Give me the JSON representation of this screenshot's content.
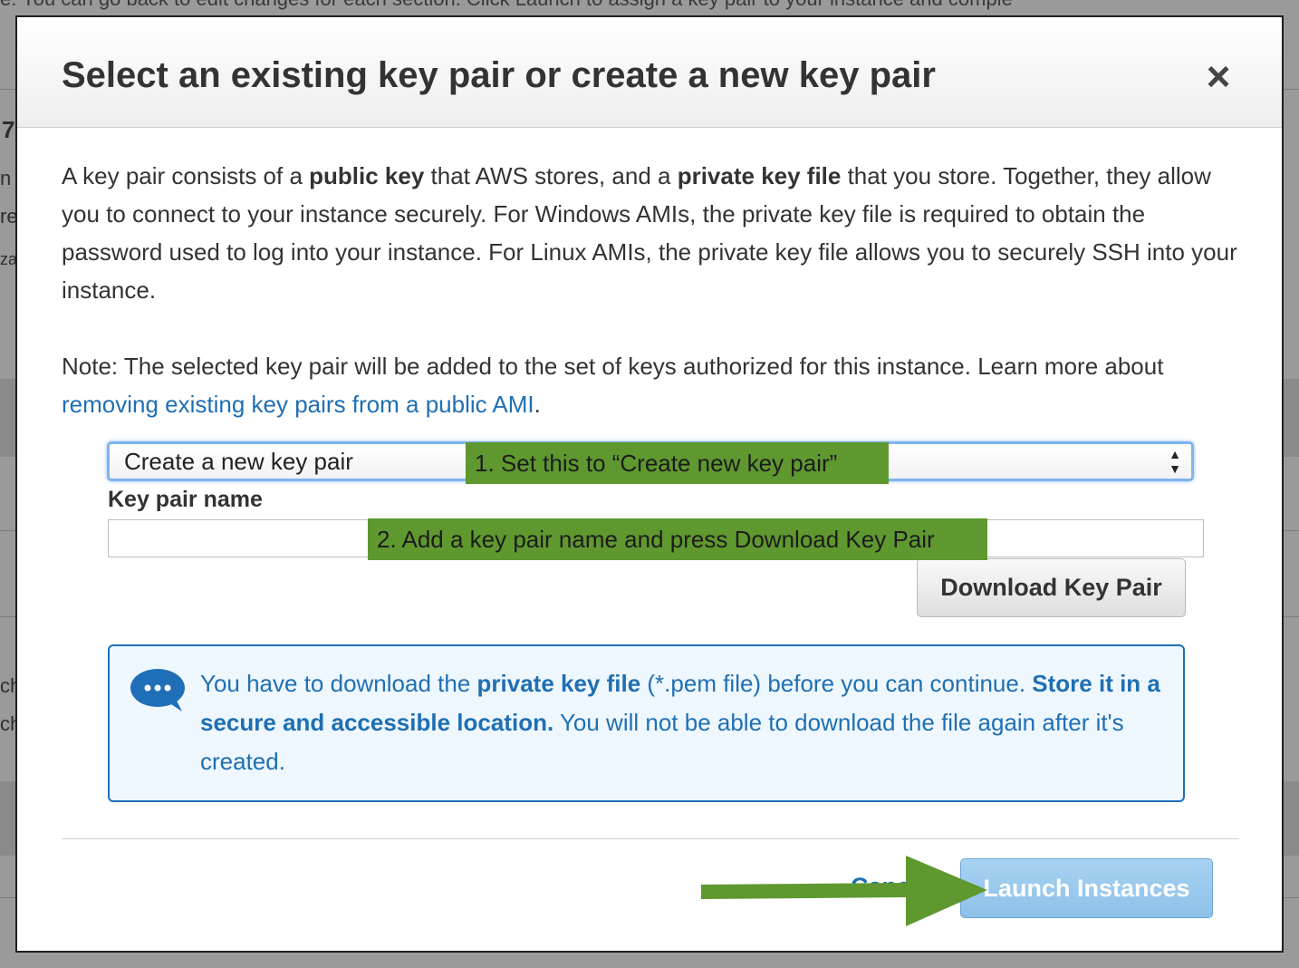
{
  "background": {
    "top_text": "e. You can go back to edit changes for each section. Click Launch to assign a key pair to your instance and comple",
    "fragments": [
      "7",
      "n",
      "re",
      "za",
      "ch",
      "ch"
    ]
  },
  "modal": {
    "title": "Select an existing key pair or create a new key pair",
    "close_icon": "close-icon",
    "intro": {
      "t1": "A key pair consists of a ",
      "b1": "public key",
      "t2": " that AWS stores, and a ",
      "b2": "private key file",
      "t3": " that you store. Together, they allow you to connect to your instance securely. For Windows AMIs, the private key file is required to obtain the password used to log into your instance. For Linux AMIs, the private key file allows you to securely SSH into your instance."
    },
    "note": {
      "text": "Note: The selected key pair will be added to the set of keys authorized for this instance. Learn more about ",
      "link": "removing existing key pairs from a public AMI",
      "end": "."
    },
    "key_pair_select": {
      "value": "Create a new key pair",
      "icon": "select-arrows-icon"
    },
    "key_pair_name": {
      "label": "Key pair name",
      "value": "",
      "placeholder": ""
    },
    "download_button": "Download Key Pair",
    "info": {
      "icon": "chat-bubble-icon",
      "t1": "You have to download the ",
      "b1": "private key file",
      "t2": " (*.pem file) before you can continue. ",
      "b2": "Store it in a secure and accessible location.",
      "t3": " You will not be able to download the file again after it's created."
    },
    "cancel": "Cancel",
    "launch_button": "Launch Instances"
  },
  "annotations": {
    "step1": "1. Set this to “Create new key pair”",
    "step2": "2. Add a key pair name and press Download Key Pair",
    "arrow_color": "#5f982f"
  },
  "colors": {
    "link": "#1f6fb3",
    "annotation": "#5f982f",
    "launch": "#8ec1e9",
    "info_border": "#1e6fb8"
  }
}
